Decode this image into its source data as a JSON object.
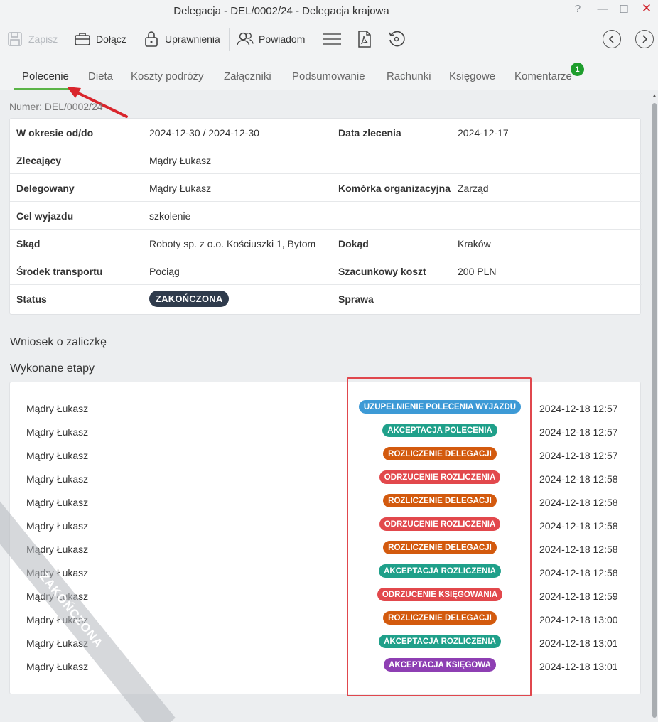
{
  "window": {
    "title": "Delegacja - DEL/0002/24 - Delegacja krajowa",
    "help": "?",
    "minimize": "—",
    "maximize": "☐",
    "close": "✕"
  },
  "toolbar": {
    "save": "Zapisz",
    "attach": "Dołącz",
    "permissions": "Uprawnienia",
    "notify": "Powiadom"
  },
  "tabs": [
    {
      "label": "Polecenie"
    },
    {
      "label": "Dieta"
    },
    {
      "label": "Koszty podróży"
    },
    {
      "label": "Załączniki"
    },
    {
      "label": "Podsumowanie"
    },
    {
      "label": "Rachunki"
    },
    {
      "label": "Księgowe"
    },
    {
      "label": "Komentarze",
      "badge": "1"
    }
  ],
  "number_line": "Numer: DEL/0002/24",
  "details": {
    "period_label": "W okresie od/do",
    "period_value": "2024-12-30 / 2024-12-30",
    "order_date_label": "Data zlecenia",
    "order_date_value": "2024-12-17",
    "orderer_label": "Zlecający",
    "orderer_value": "Mądry Łukasz",
    "delegate_label": "Delegowany",
    "delegate_value": "Mądry Łukasz",
    "unit_label": "Komórka organizacyjna",
    "unit_value": "Zarząd",
    "purpose_label": "Cel wyjazdu",
    "purpose_value": "szkolenie",
    "from_label": "Skąd",
    "from_value": "Roboty sp. z o.o. Kościuszki 1, Bytom",
    "to_label": "Dokąd",
    "to_value": "Kraków",
    "transport_label": "Środek transportu",
    "transport_value": "Pociąg",
    "cost_label": "Szacunkowy koszt",
    "cost_value": "200 PLN",
    "status_label": "Status",
    "status_value": "ZAKOŃCZONA",
    "case_label": "Sprawa"
  },
  "sections": {
    "advance": "Wniosek o zaliczkę",
    "stages": "Wykonane etapy"
  },
  "stages": [
    {
      "user": "Mądry Łukasz",
      "stage": "UZUPEŁNIENIE POLECENIA WYJAZDU",
      "color": "#3d9ad6",
      "date": "2024-12-18 12:57"
    },
    {
      "user": "Mądry Łukasz",
      "stage": "AKCEPTACJA POLECENIA",
      "color": "#1fa08a",
      "date": "2024-12-18 12:57"
    },
    {
      "user": "Mądry Łukasz",
      "stage": "ROZLICZENIE DELEGACJI",
      "color": "#d35a0e",
      "date": "2024-12-18 12:57"
    },
    {
      "user": "Mądry Łukasz",
      "stage": "ODRZUCENIE ROZLICZENIA",
      "color": "#e2484c",
      "date": "2024-12-18 12:58"
    },
    {
      "user": "Mądry Łukasz",
      "stage": "ROZLICZENIE DELEGACJI",
      "color": "#d35a0e",
      "date": "2024-12-18 12:58"
    },
    {
      "user": "Mądry Łukasz",
      "stage": "ODRZUCENIE ROZLICZENIA",
      "color": "#e2484c",
      "date": "2024-12-18 12:58"
    },
    {
      "user": "Mądry Łukasz",
      "stage": "ROZLICZENIE DELEGACJI",
      "color": "#d35a0e",
      "date": "2024-12-18 12:58"
    },
    {
      "user": "Mądry Łukasz",
      "stage": "AKCEPTACJA ROZLICZENIA",
      "color": "#1fa08a",
      "date": "2024-12-18 12:58"
    },
    {
      "user": "Mądry Łukasz",
      "stage": "ODRZUCENIE KSIĘGOWANIA",
      "color": "#e2484c",
      "date": "2024-12-18 12:59"
    },
    {
      "user": "Mądry Łukasz",
      "stage": "ROZLICZENIE DELEGACJI",
      "color": "#d35a0e",
      "date": "2024-12-18 13:00"
    },
    {
      "user": "Mądry Łukasz",
      "stage": "AKCEPTACJA ROZLICZENIA",
      "color": "#1fa08a",
      "date": "2024-12-18 13:01"
    },
    {
      "user": "Mądry Łukasz",
      "stage": "AKCEPTACJA KSIĘGOWA",
      "color": "#8e3fb3",
      "date": "2024-12-18 13:01"
    }
  ],
  "watermark": "ZAKOŃCZONA",
  "colors": {
    "accent_green": "#5bb447",
    "status_dark": "#2f3b4c",
    "annotation_red": "#e0474d"
  }
}
